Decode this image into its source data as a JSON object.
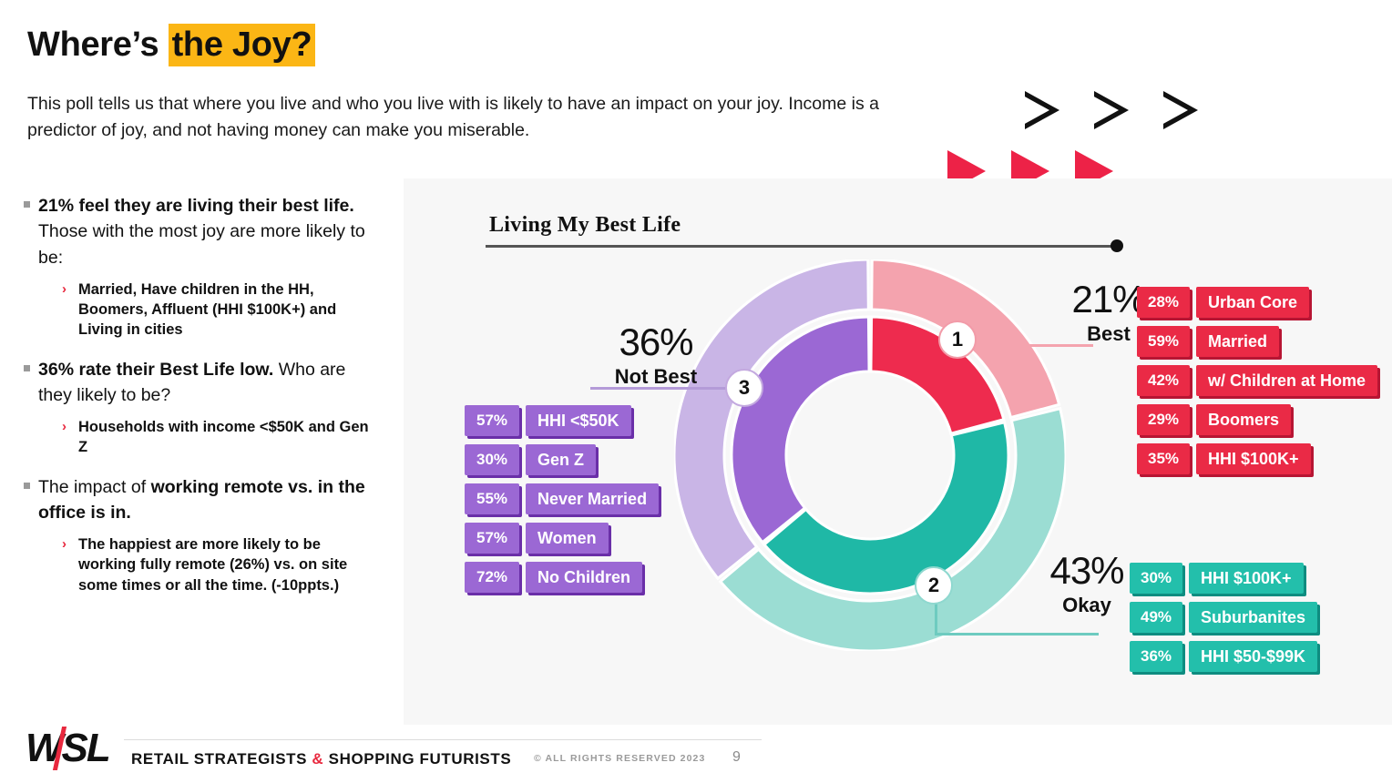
{
  "header": {
    "title_plain": "Where’s ",
    "title_highlight": "the Joy?",
    "highlight_color": "#FBB615",
    "subtitle": "This poll tells us that where you live and who you live with is likely to have an impact on your joy.  Income is a predictor of joy, and not having money can make you miserable."
  },
  "decor": {
    "outline_arrow_icon": "triangle-right-outline-icon",
    "filled_arrow_icon": "triangle-right-filled-icon",
    "outline_arrow_count": 3,
    "filled_arrow_count": 3,
    "filled_arrow_color": "#ED2247"
  },
  "left_column": {
    "bullets": [
      {
        "marker": "square-bullet-icon",
        "bold_lead": "21% feel they are living their best life.",
        "rest": "  Those with the most joy are more likely to be:",
        "sub": [
          {
            "marker": "chevron-right-icon",
            "text": "Married, Have children in the HH, Boomers, Affluent (HHI $100K+) and Living in cities"
          }
        ]
      },
      {
        "marker": "square-bullet-icon",
        "bold_lead": "36% rate their Best Life low.",
        "rest": " Who are they likely to be?",
        "sub": [
          {
            "marker": "chevron-right-icon",
            "text": "Households with income <$50K and Gen Z"
          }
        ]
      },
      {
        "marker": "square-bullet-icon",
        "plain_lead": "The impact of ",
        "bold_mid": "working remote vs. in the office is in.",
        "sub": [
          {
            "marker": "chevron-right-icon",
            "text": "The happiest are more likely to be working fully remote (26%) vs. on site some times or all the time. (-10ppts.)"
          }
        ]
      }
    ]
  },
  "chart_data": {
    "type": "pie",
    "title": "Living My Best Life",
    "subtitle": "",
    "xlabel": "",
    "ylabel": "",
    "legend_position": "right-and-left",
    "grid": false,
    "categories": [
      "Best",
      "Okay",
      "Not Best"
    ],
    "values": [
      21,
      43,
      36
    ],
    "units": "%",
    "rings": [
      {
        "name": "outer-ring",
        "colors": [
          "#F4A3AE",
          "#9BDDD3",
          "#C9B5E6"
        ]
      },
      {
        "name": "inner-ring",
        "colors": [
          "#EE2B4E",
          "#1FB8A6",
          "#9B68D4"
        ]
      }
    ],
    "slices": [
      {
        "callout": "1",
        "label": "Best",
        "value": 21,
        "value_text": "21%",
        "accent": "#EE2B4E",
        "breakdown": [
          {
            "pct": "28%",
            "label": "Urban Core"
          },
          {
            "pct": "59%",
            "label": "Married"
          },
          {
            "pct": "42%",
            "label": "w/ Children at Home"
          },
          {
            "pct": "29%",
            "label": "Boomers"
          },
          {
            "pct": "35%",
            "label": "HHI $100K+"
          }
        ]
      },
      {
        "callout": "2",
        "label": "Okay",
        "value": 43,
        "value_text": "43%",
        "accent": "#1FB8A6",
        "breakdown": [
          {
            "pct": "30%",
            "label": "HHI $100K+"
          },
          {
            "pct": "49%",
            "label": "Suburbanites"
          },
          {
            "pct": "36%",
            "label": "HHI $50-$99K"
          }
        ]
      },
      {
        "callout": "3",
        "label": "Not Best",
        "value": 36,
        "value_text": "36%",
        "accent": "#9B68D4",
        "breakdown": [
          {
            "pct": "57%",
            "label": "HHI <$50K"
          },
          {
            "pct": "30%",
            "label": "Gen Z"
          },
          {
            "pct": "55%",
            "label": "Never Married"
          },
          {
            "pct": "57%",
            "label": "Women"
          },
          {
            "pct": "72%",
            "label": "No Children"
          }
        ]
      }
    ]
  },
  "footer": {
    "logo": "WSL",
    "tagline_before": "RETAIL STRATEGISTS ",
    "tagline_amp": "&",
    "tagline_after": " SHOPPING FUTURISTS",
    "copyright": "© ALL RIGHTS RESERVED 2023",
    "page_number": "9"
  }
}
